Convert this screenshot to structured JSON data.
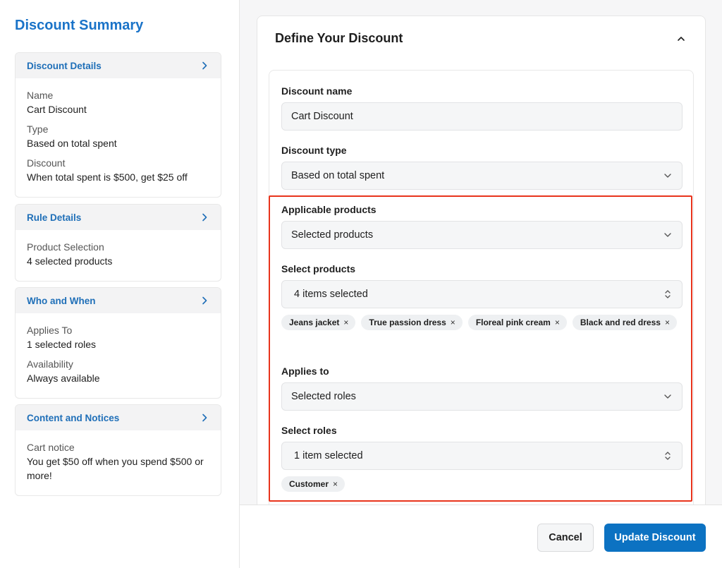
{
  "sidebar": {
    "title": "Discount Summary",
    "sections": [
      {
        "heading": "Discount Details",
        "fields": [
          {
            "label": "Name",
            "value": "Cart Discount"
          },
          {
            "label": "Type",
            "value": "Based on total spent"
          },
          {
            "label": "Discount",
            "value": "When total spent is $500, get $25 off"
          }
        ]
      },
      {
        "heading": "Rule Details",
        "fields": [
          {
            "label": "Product Selection",
            "value": "4 selected products"
          }
        ]
      },
      {
        "heading": "Who and When",
        "fields": [
          {
            "label": "Applies To",
            "value": "1 selected roles"
          },
          {
            "label": "Availability",
            "value": "Always available"
          }
        ]
      },
      {
        "heading": "Content and Notices",
        "fields": [
          {
            "label": "Cart notice",
            "value": "You get $50 off when you spend $500 or more!"
          }
        ]
      }
    ]
  },
  "panel": {
    "title": "Define Your Discount",
    "form": {
      "discount_name": {
        "label": "Discount name",
        "value": "Cart Discount"
      },
      "discount_type": {
        "label": "Discount type",
        "value": "Based on total spent"
      },
      "applicable_products": {
        "label": "Applicable products",
        "value": "Selected products"
      },
      "select_products": {
        "label": "Select products",
        "value": "4 items selected",
        "tags": [
          "Jeans jacket",
          "True passion dress",
          "Floreal pink cream",
          "Black and red dress"
        ]
      },
      "applies_to": {
        "label": "Applies to",
        "value": "Selected roles"
      },
      "select_roles": {
        "label": "Select roles",
        "value": "1 item selected",
        "tags": [
          "Customer"
        ]
      }
    }
  },
  "footer": {
    "cancel_label": "Cancel",
    "submit_label": "Update Discount"
  },
  "colors": {
    "accent": "#1a73c8",
    "primary_button": "#0c72c2",
    "highlight": "#e8341c"
  },
  "icons": {
    "tag_remove": "×"
  }
}
